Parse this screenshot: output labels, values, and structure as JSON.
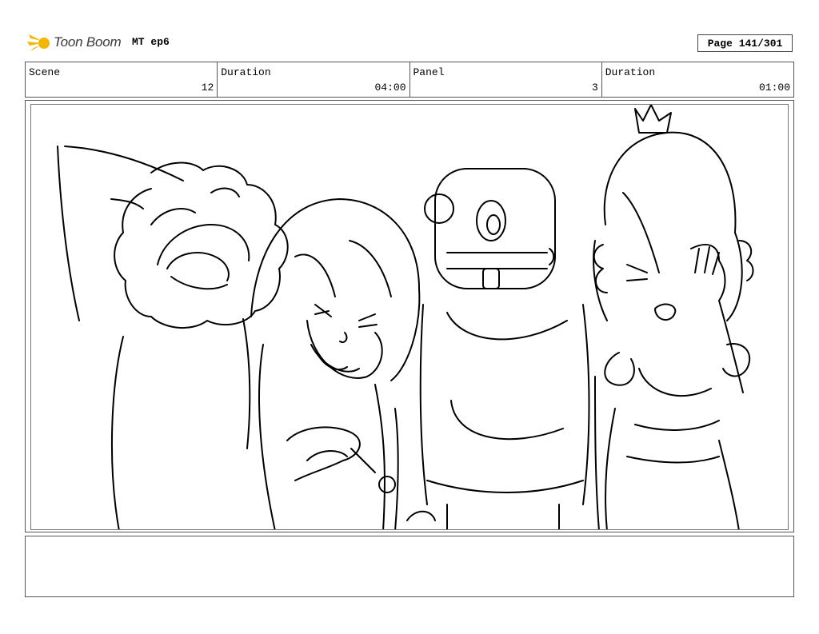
{
  "header": {
    "brand": "Toon Boom",
    "episode": "MT ep6",
    "page": "Page 141/301"
  },
  "info": {
    "scene_label": "Scene",
    "scene_value": "12",
    "duration_label": "Duration",
    "duration_value": "04:00",
    "panel_label": "Panel",
    "panel_value": "3",
    "panel_duration_label": "Duration",
    "panel_duration_value": "01:00"
  },
  "colors": {
    "logo_accent": "#f2b705",
    "line": "#000000"
  }
}
